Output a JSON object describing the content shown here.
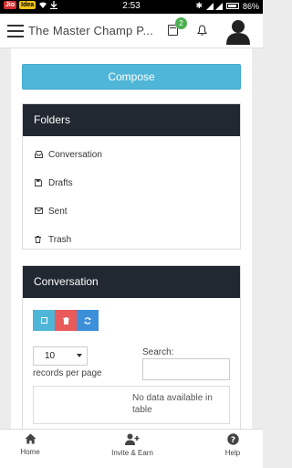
{
  "status_bar": {
    "app1": "Jio",
    "app2": "Idea",
    "time": "2:53",
    "battery": "86%"
  },
  "header": {
    "title": "The Master Champ P...",
    "calendar_badge": "2",
    "icons": [
      "menu-icon",
      "calendar-icon",
      "bell-icon",
      "avatar"
    ]
  },
  "compose": {
    "label": "Compose"
  },
  "folders": {
    "title": "Folders",
    "items": [
      {
        "label": "Conversation",
        "icon": "inbox-icon"
      },
      {
        "label": "Drafts",
        "icon": "save-icon"
      },
      {
        "label": "Sent",
        "icon": "envelope-icon"
      },
      {
        "label": "Trash",
        "icon": "trash-icon"
      }
    ]
  },
  "conversation": {
    "title": "Conversation",
    "page_length": "10",
    "records_per_page_label": "records per page",
    "search_label": "Search:",
    "search_value": "",
    "empty_message": "No data available in table"
  },
  "bottom_nav": {
    "home": "Home",
    "invite": "Invite & Earn",
    "help": "Help"
  },
  "colors": {
    "compose_button": "#4fb6d8",
    "panel_header": "#222831",
    "delete_button": "#e95a5a",
    "refresh_button": "#3d8fd9",
    "badge": "#4caf50"
  }
}
